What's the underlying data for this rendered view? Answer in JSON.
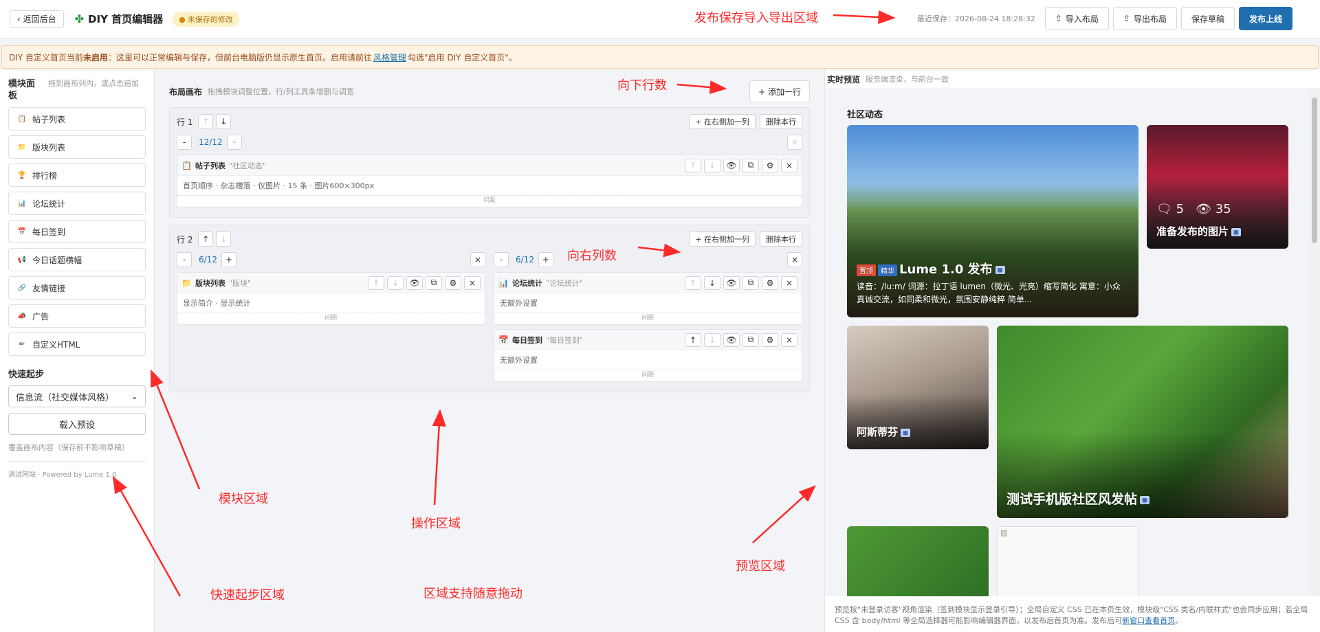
{
  "topbar": {
    "back_label": "‹ 返回后台",
    "title": "DIY 首页编辑器",
    "unsaved": "未保存的修改",
    "last_save": "最近保存：2026-08-24 18:28:32",
    "import_label": "导入布局",
    "export_label": "导出布局",
    "save_draft_label": "保存草稿",
    "publish_label": "发布上线"
  },
  "warning": {
    "prefix": "DIY 自定义首页当前",
    "bold": "未启用",
    "middle": "：这里可以正常编辑与保存，但前台电脑版仍显示原生首页。启用请前往",
    "link": "风格管理",
    "suffix": "勾选\"启用 DIY 自定义首页\"。"
  },
  "left": {
    "title": "模块面板",
    "desc": "拖到画布列内，或点击追加",
    "modules": [
      {
        "label": "帖子列表",
        "icon": "clipboard-icon"
      },
      {
        "label": "版块列表",
        "icon": "folder-icon"
      },
      {
        "label": "排行榜",
        "icon": "trophy-icon"
      },
      {
        "label": "论坛统计",
        "icon": "bar-chart-icon"
      },
      {
        "label": "每日签到",
        "icon": "calendar-icon"
      },
      {
        "label": "今日话题横幅",
        "icon": "megaphone-icon"
      },
      {
        "label": "友情链接",
        "icon": "link-icon"
      },
      {
        "label": "广告",
        "icon": "ad-icon"
      },
      {
        "label": "自定义HTML",
        "icon": "pencil-icon"
      }
    ],
    "quickstart_title": "快速起步",
    "preset_value": "信息流（社交媒体风格）",
    "load_preset": "载入预设",
    "cover_note": "覆盖画布内容（保存前不影响草稿）",
    "footer": "调试网站 · Powered by Lume 1.0"
  },
  "canvas": {
    "title": "布局画布",
    "desc": "拖拽模块调整位置，行/列工具条增删与调宽",
    "add_row": "+ 添加一行",
    "add_col": "+ 在右侧加一列",
    "del_row": "删除本行",
    "gap": "间距",
    "rows": [
      {
        "label": "行 1",
        "cols": [
          {
            "width": "12/12",
            "blocks": [
              {
                "name": "帖子列表",
                "title": "\"社区动态\"",
                "body": "首页顺序 · 杂志槽落 · 仅图片 · 15 条 · 图片600×300px"
              }
            ]
          }
        ]
      },
      {
        "label": "行 2",
        "cols": [
          {
            "width": "6/12",
            "blocks": [
              {
                "name": "版块列表",
                "title": "\"版块\"",
                "body": "显示简介 · 显示统计"
              }
            ]
          },
          {
            "width": "6/12",
            "blocks": [
              {
                "name": "论坛统计",
                "title": "\"论坛统计\"",
                "body": "无额外设置"
              },
              {
                "name": "每日签到",
                "title": "\"每日签到\"",
                "body": "无额外设置"
              }
            ]
          }
        ]
      }
    ]
  },
  "preview": {
    "title": "实时预览",
    "desc": "服务端渲染，与前台一致",
    "section": "社区动态",
    "cards": [
      {
        "title": "Lume 1.0 发布",
        "tag_top": "置顶",
        "tag_good": "精华",
        "excerpt": "读音：/lu:m/ 词源：拉丁语 lumen（微光、光亮）缩写简化 寓意：小众真诚交流，如同柔和微光，氛围安静纯粹 简单..."
      },
      {
        "title": "准备发布的图片",
        "comments": "5",
        "views": "35"
      },
      {
        "title": "阿斯蒂芬"
      },
      {
        "title": "测试手机版社区风发帖"
      }
    ],
    "note_text": "预览按\"未登录访客\"视角渲染（签到模块显示登录引导）；全局自定义 CSS 已在本页生效，模块级\"CSS 类名/内联样式\"也会同步应用；若全局 CSS 含 body/html 等全局选择器可能影响编辑器界面，以发布后首页为准。发布后可",
    "note_link": "新窗口查看首页",
    "note_end": "。"
  },
  "annotations": {
    "publish_area": "发布保存导入导出区域",
    "add_rows": "向下行数",
    "add_cols": "向右列数",
    "module_area": "模块区域",
    "operation_area": "操作区域",
    "preview_area": "预览区域",
    "quickstart_area": "快速起步区域",
    "drag_note": "区域支持随意拖动"
  }
}
